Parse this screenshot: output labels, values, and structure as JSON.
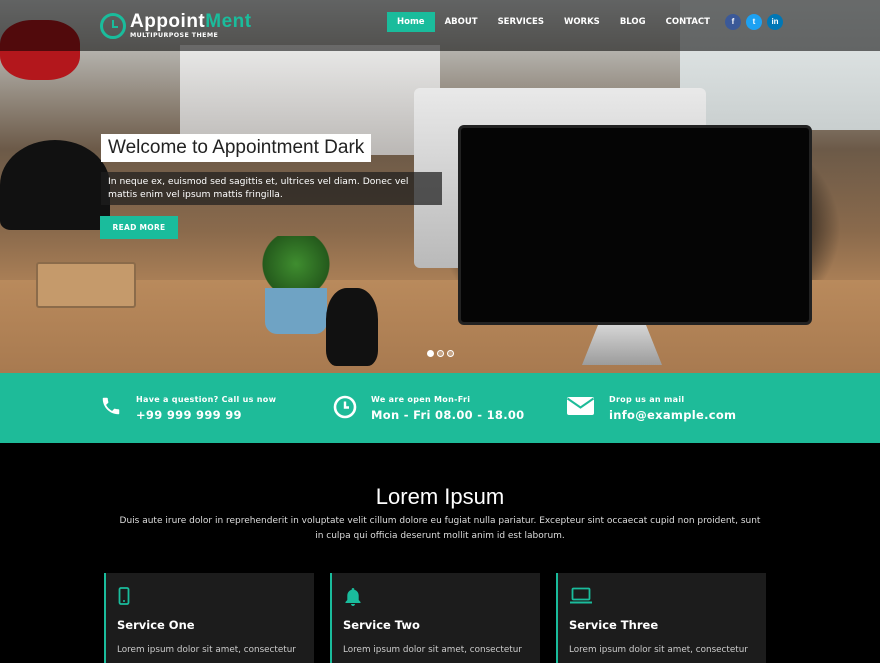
{
  "header": {
    "logo_main_white": "Appoint",
    "logo_main_green": "Ment",
    "logo_sub": "MULTIPURPOSE THEME",
    "nav": [
      "Home",
      "ABOUT",
      "SERVICES",
      "WORKS",
      "BLOG",
      "CONTACT"
    ],
    "social": [
      {
        "icon": "facebook-icon",
        "glyph": "f",
        "color": "#3b5998"
      },
      {
        "icon": "twitter-icon",
        "glyph": "t",
        "color": "#1da1f2"
      },
      {
        "icon": "linkedin-icon",
        "glyph": "in",
        "color": "#0077b5"
      }
    ]
  },
  "hero": {
    "title": "Welcome to Appointment Dark",
    "description": "In neque ex, euismod sed sagittis et, ultrices vel diam. Donec vel mattis enim vel ipsum mattis fringilla.",
    "button": "READ MORE",
    "slides": 3,
    "active_slide": 1
  },
  "infobar": {
    "items": [
      {
        "icon": "phone-icon",
        "label": "Have a question? Call us now",
        "value": "+99 999 999 99"
      },
      {
        "icon": "clock-icon",
        "label": "We are open Mon-Fri",
        "value": "Mon - Fri 08.00 - 18.00"
      },
      {
        "icon": "envelope-icon",
        "label": "Drop us an mail",
        "value": "info@example.com"
      }
    ]
  },
  "services": {
    "title": "Lorem Ipsum",
    "description": "Duis aute irure dolor in reprehenderit in voluptate velit cillum dolore eu fugiat nulla pariatur. Excepteur sint occaecat cupid non proident, sunt in culpa qui officia deserunt mollit anim id est laborum.",
    "cards": [
      {
        "icon": "mobile-icon",
        "title": "Service One",
        "text": "Lorem ipsum dolor sit amet, consectetur"
      },
      {
        "icon": "bell-icon",
        "title": "Service Two",
        "text": "Lorem ipsum dolor sit amet, consectetur"
      },
      {
        "icon": "laptop-icon",
        "title": "Service Three",
        "text": "Lorem ipsum dolor sit amet, consectetur"
      }
    ]
  },
  "colors": {
    "accent": "#1abc9c",
    "infobar": "#1ebb99",
    "card_bg": "#1c1c1c"
  }
}
